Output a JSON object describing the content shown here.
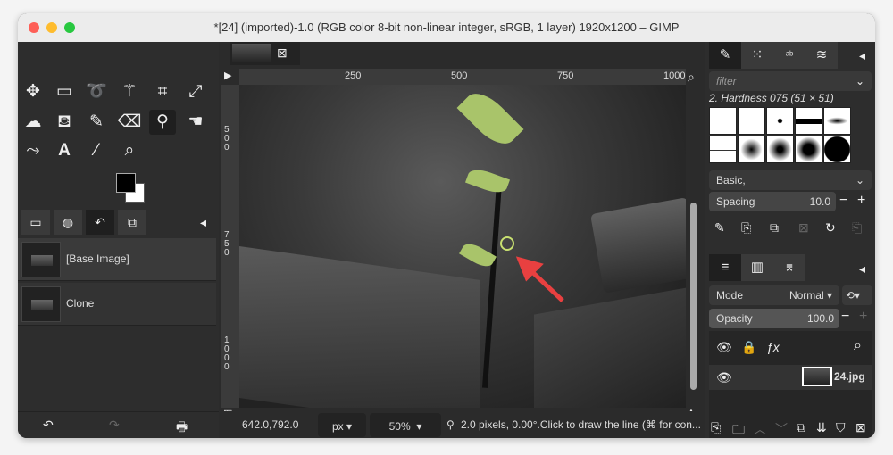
{
  "title": "*[24] (imported)-1.0 (RGB color 8-bit non-linear integer, sRGB, 1 layer) 1920x1200 – GIMP",
  "toolbox": {
    "history_items": [
      {
        "label": "[Base Image]"
      },
      {
        "label": "Clone"
      }
    ]
  },
  "ruler": {
    "h_ticks": [
      "250",
      "500",
      "750",
      "1000"
    ],
    "v_ticks": [
      "500",
      "750",
      "1000"
    ]
  },
  "brushes": {
    "filter_placeholder": "filter",
    "selected_brush": "2. Hardness 075 (51 × 51)",
    "preset": "Basic,",
    "spacing_label": "Spacing",
    "spacing_value": "10.0"
  },
  "layers": {
    "mode_label": "Mode",
    "mode_value": "Normal",
    "opacity_label": "Opacity",
    "opacity_value": "100.0",
    "items": [
      {
        "name": "24.jpg"
      }
    ]
  },
  "status": {
    "coords": "642.0,792.0",
    "unit": "px",
    "zoom": "50%",
    "message": "2.0 pixels, 0.00°.Click to draw the line (⌘ for con..."
  },
  "colors": {
    "fg": "#000000",
    "bg": "#ffffff",
    "leaf": "#a9c46a"
  }
}
